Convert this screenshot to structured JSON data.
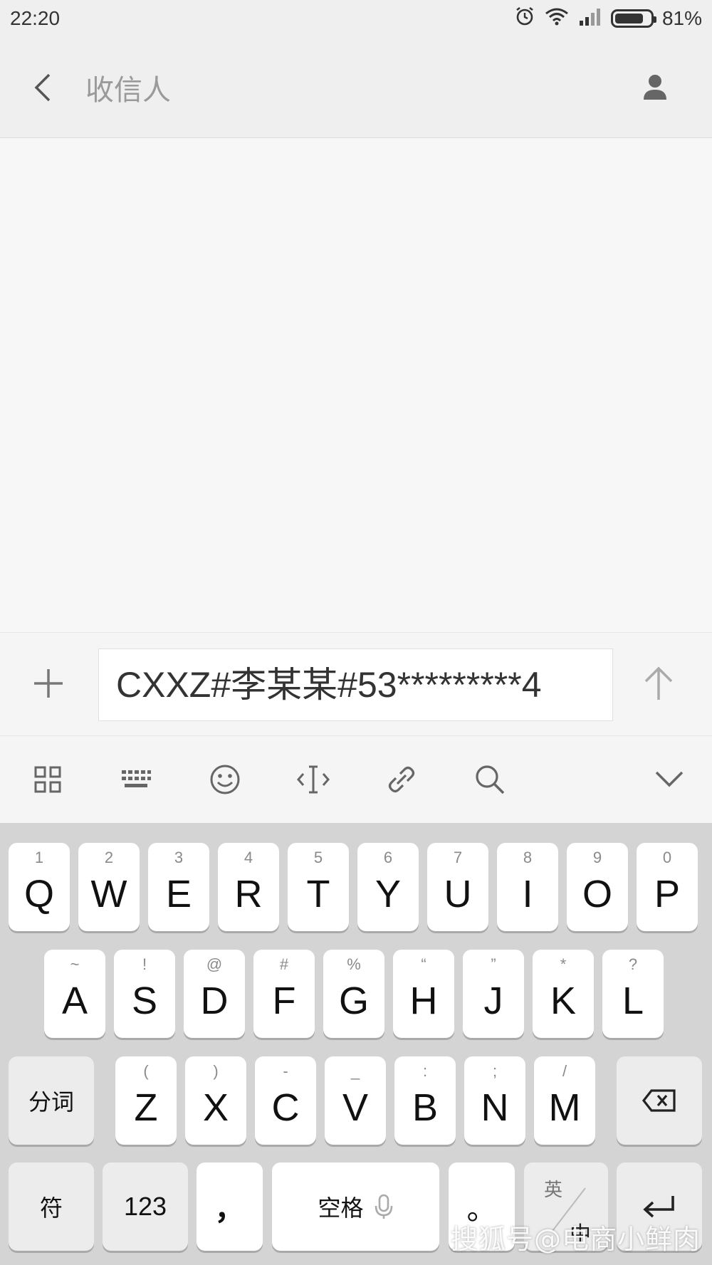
{
  "status_bar": {
    "time": "22:20",
    "battery_percent": "81%",
    "battery_level": 0.81,
    "icons": [
      "alarm-icon",
      "wifi-icon",
      "signal-icon",
      "battery-icon"
    ]
  },
  "header": {
    "back_icon": "chevron-left-icon",
    "title": "收信人",
    "contact_icon": "person-icon"
  },
  "compose": {
    "attach_icon": "plus-icon",
    "message_text": "CXXZ#李某某#53*********4",
    "send_icon": "arrow-up-icon"
  },
  "keyboard_toolbar": {
    "tools": [
      "grid-icon",
      "keyboard-icon",
      "emoji-icon",
      "cursor-icon",
      "link-icon",
      "search-icon",
      "chevron-down-icon"
    ]
  },
  "keyboard": {
    "row1": [
      {
        "key": "Q",
        "hint": "1"
      },
      {
        "key": "W",
        "hint": "2"
      },
      {
        "key": "E",
        "hint": "3"
      },
      {
        "key": "R",
        "hint": "4"
      },
      {
        "key": "T",
        "hint": "5"
      },
      {
        "key": "Y",
        "hint": "6"
      },
      {
        "key": "U",
        "hint": "7"
      },
      {
        "key": "I",
        "hint": "8"
      },
      {
        "key": "O",
        "hint": "9"
      },
      {
        "key": "P",
        "hint": "0"
      }
    ],
    "row2": [
      {
        "key": "A",
        "hint": "~"
      },
      {
        "key": "S",
        "hint": "!"
      },
      {
        "key": "D",
        "hint": "@"
      },
      {
        "key": "F",
        "hint": "#"
      },
      {
        "key": "G",
        "hint": "%"
      },
      {
        "key": "H",
        "hint": "“"
      },
      {
        "key": "J",
        "hint": "”"
      },
      {
        "key": "K",
        "hint": "*"
      },
      {
        "key": "L",
        "hint": "?"
      }
    ],
    "row3": [
      {
        "key": "Z",
        "hint": "("
      },
      {
        "key": "X",
        "hint": ")"
      },
      {
        "key": "C",
        "hint": "-"
      },
      {
        "key": "V",
        "hint": "_"
      },
      {
        "key": "B",
        "hint": ":"
      },
      {
        "key": "N",
        "hint": ";"
      },
      {
        "key": "M",
        "hint": "/"
      }
    ],
    "segment_label": "分词",
    "backspace_icon": "backspace-icon",
    "symbols_label": "符",
    "numbers_label": "123",
    "comma_label": "，",
    "space_label": "空格",
    "mic_icon": "microphone-icon",
    "period_label": "。",
    "lang_top": "英",
    "lang_bottom": "中",
    "enter_icon": "enter-icon"
  },
  "watermark": "搜狐号@电商小鲜肉"
}
